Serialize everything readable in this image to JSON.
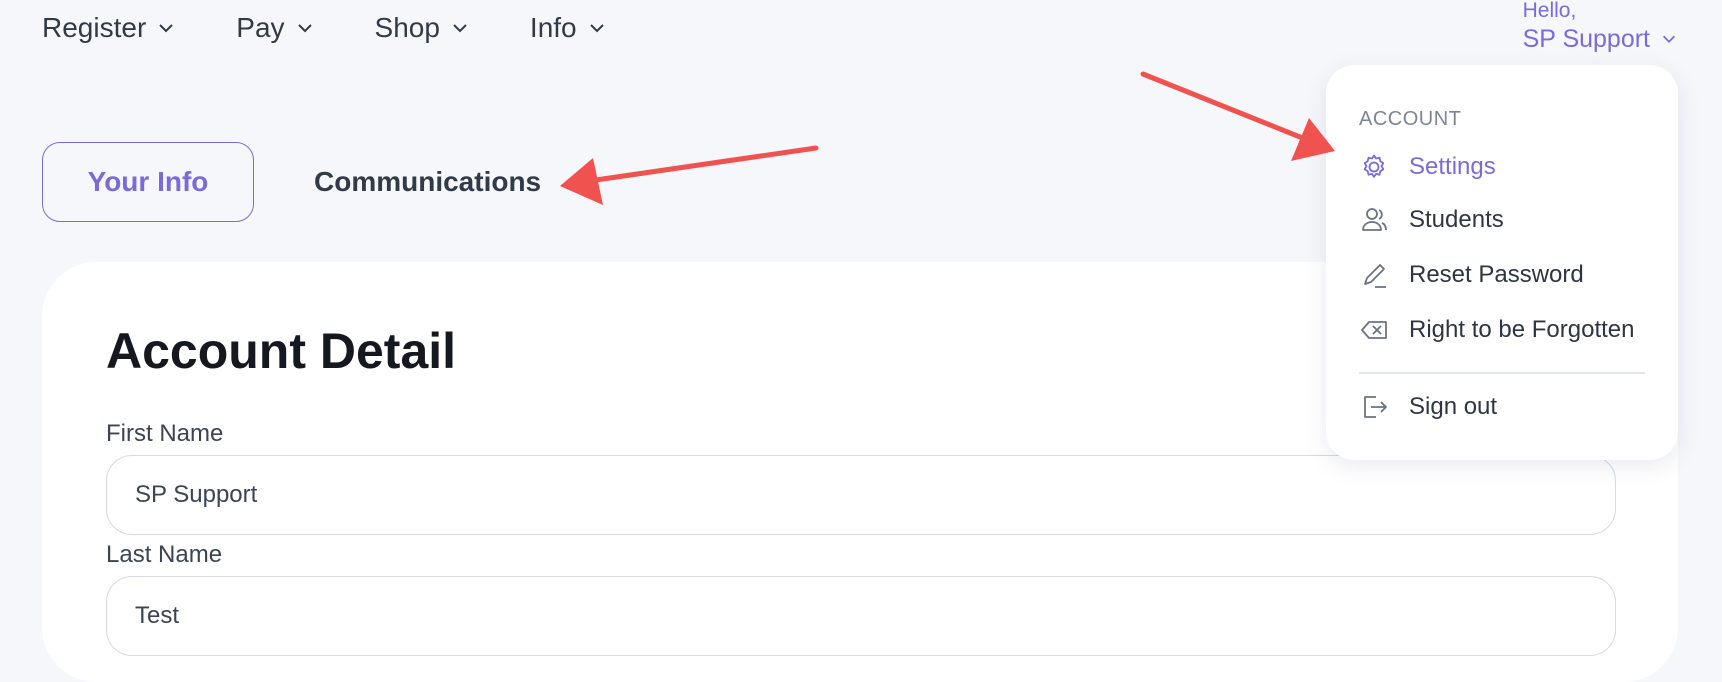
{
  "nav": {
    "items": [
      {
        "label": "Register",
        "icon": "chevron-down-icon"
      },
      {
        "label": "Pay",
        "icon": "chevron-down-icon"
      },
      {
        "label": "Shop",
        "icon": "chevron-down-icon"
      },
      {
        "label": "Info",
        "icon": "chevron-down-icon"
      }
    ]
  },
  "user": {
    "greeting": "Hello,",
    "name": "SP Support"
  },
  "tabs": {
    "active": "Your Info",
    "other": "Communications"
  },
  "card": {
    "title": "Account Detail",
    "first_name_label": "First Name",
    "first_name_value": "SP Support",
    "last_name_label": "Last Name",
    "last_name_value": "Test"
  },
  "menu": {
    "section": "ACCOUNT",
    "items": [
      {
        "label": "Settings",
        "icon": "gear-icon"
      },
      {
        "label": "Students",
        "icon": "user-icon"
      },
      {
        "label": "Reset Password",
        "icon": "pencil-icon"
      },
      {
        "label": "Right to be Forgotten",
        "icon": "backspace-icon"
      },
      {
        "label": "Sign out",
        "icon": "sign-out-icon"
      }
    ]
  },
  "colors": {
    "accent": "#7c6ad6",
    "arrow": "#f0524f",
    "background": "#f5f7fb"
  }
}
